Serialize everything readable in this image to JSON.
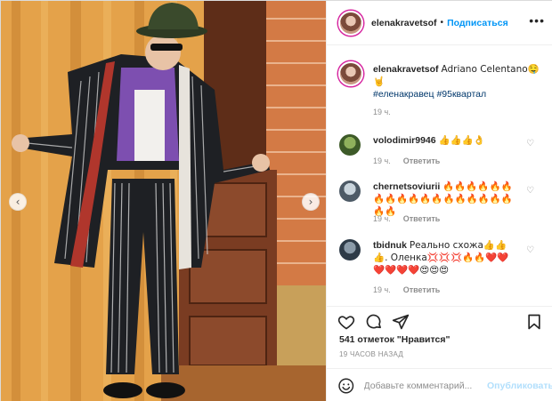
{
  "post": {
    "username": "elenakravetsof",
    "separator": "•",
    "follow_label": "Подписаться",
    "more_label": "•••",
    "caption_text": "Adriano Celentano🤤🤘",
    "caption_tags": "#еленакравец #95квартал",
    "caption_time": "19 ч."
  },
  "photo": {
    "prev_label": "‹",
    "next_label": "›",
    "description_colors": {
      "curtain": "#e6a84a",
      "door": "#7a3c22",
      "brick": "#d9804d",
      "suit": "#1e2024",
      "shirt": "#7d4fb0"
    }
  },
  "comments": [
    {
      "username": "volodimir9946",
      "text": "👍👍👍👌",
      "time": "19 ч.",
      "reply": "Ответить"
    },
    {
      "username": "chernetsoviurii",
      "text": "🔥🔥🔥🔥🔥🔥🔥🔥🔥🔥🔥🔥🔥🔥🔥🔥🔥🔥🔥🔥",
      "time": "19 ч.",
      "reply": "Ответить"
    },
    {
      "username": "tbidnuk",
      "text": "Реально схожа👍👍👍. Оленка💢💢💢🔥🔥❤️❤️❤️❤️❤️❤️😍😍😍",
      "time": "19 ч.",
      "reply": "Ответить"
    }
  ],
  "actions": {
    "likes": "541 отметок \"Нравится\"",
    "time_ago": "19 ЧАСОВ НАЗАД"
  },
  "add_comment": {
    "placeholder": "Добавьте комментарий...",
    "post_label": "Опубликовать"
  },
  "colors": {
    "accent": "#0095f6",
    "link": "#00376b",
    "muted": "#8e8e8e",
    "post_disabled": "#b2dffc"
  }
}
